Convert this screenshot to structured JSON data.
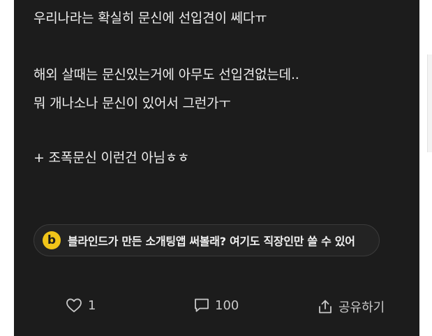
{
  "post": {
    "lines": [
      "우리나라는 확실히 문신에 선입견이 쎄다ㅠ",
      "해외 살때는 문신있는거에 아무도 선입견없는데..",
      "뭐 개나소나 문신이 있어서 그런가ㅜ",
      "+ 조폭문신 이런건 아님ㅎㅎ"
    ]
  },
  "promo": {
    "logo_letter": "b",
    "text": "블라인드가 만든 소개팅앱 써볼래? 여기도 직장인만 쓸 수 있어"
  },
  "actions": {
    "like_count": "1",
    "comment_count": "100",
    "share_label": "공유하기"
  },
  "colors": {
    "background": "#1c1c1c",
    "text": "#ededed",
    "logo_accent": "#f0c419"
  },
  "icons": {
    "like": "heart-icon",
    "comment": "comment-icon",
    "share": "share-icon"
  }
}
